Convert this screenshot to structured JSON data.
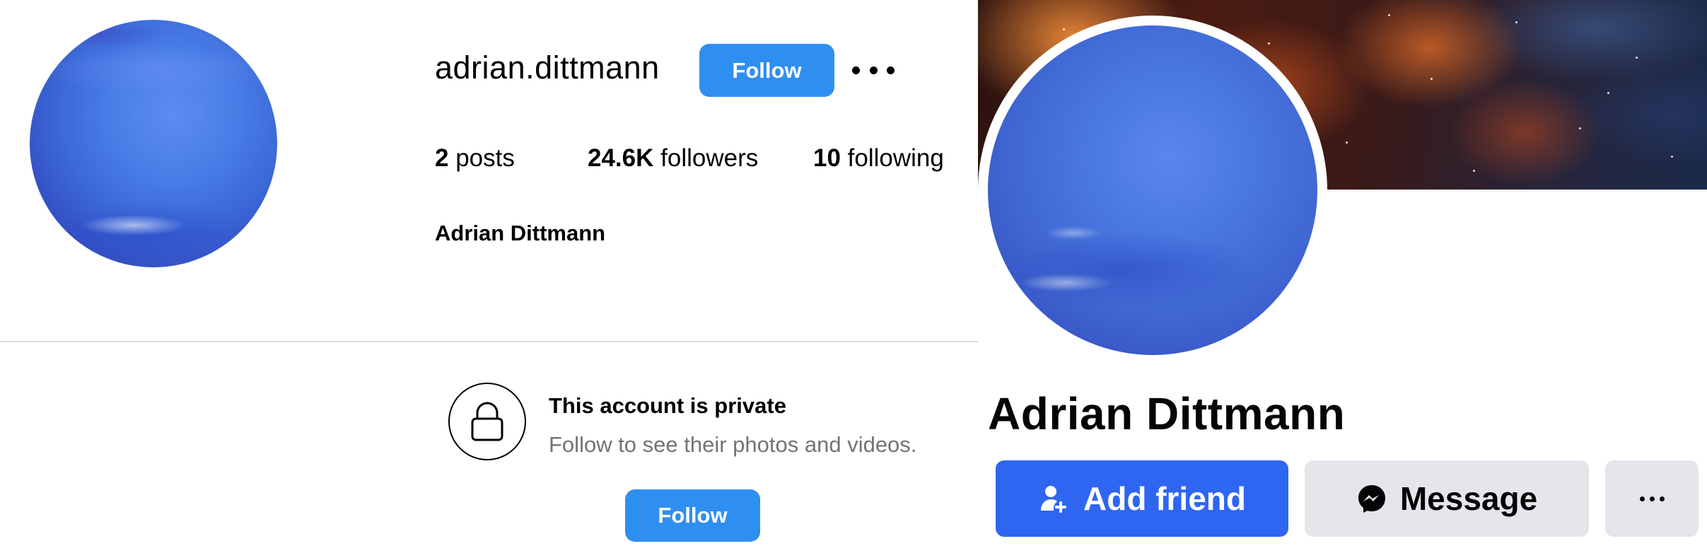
{
  "instagram_profile": {
    "username": "adrian.dittmann",
    "follow_button_label": "Follow",
    "more_options_icon": "more-horizontal-icon",
    "stats": {
      "posts_count": "2",
      "posts_label": "posts",
      "followers_count": "24.6K",
      "followers_label": "followers",
      "following_count": "10",
      "following_label": "following"
    },
    "full_name": "Adrian Dittmann",
    "private_notice": {
      "icon": "lock-icon",
      "title": "This account is private",
      "subtitle": "Follow to see their photos and videos.",
      "follow_button_label": "Follow"
    },
    "accent_color": "#2f8ff0"
  },
  "facebook_profile": {
    "name": "Adrian Dittmann",
    "add_friend_label": "Add friend",
    "add_friend_icon": "add-person-icon",
    "message_label": "Message",
    "message_icon": "messenger-icon",
    "more_icon": "more-horizontal-icon",
    "accent_color": "#2f66f1"
  }
}
